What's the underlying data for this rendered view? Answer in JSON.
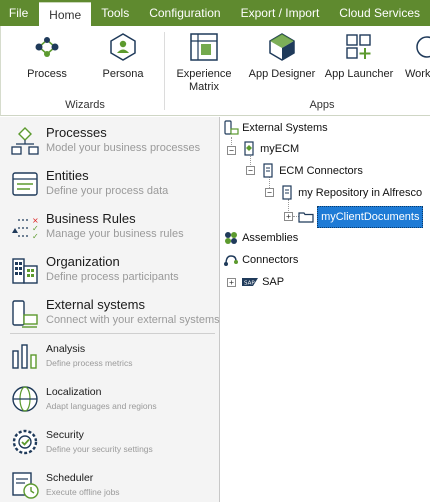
{
  "menubar": {
    "tabs": [
      {
        "label": "File"
      },
      {
        "label": "Home"
      },
      {
        "label": "Tools"
      },
      {
        "label": "Configuration"
      },
      {
        "label": "Export / Import"
      },
      {
        "label": "Cloud Services"
      }
    ],
    "active": "Home"
  },
  "ribbon": {
    "wizards": {
      "label": "Wizards",
      "buttons": [
        {
          "label": "Process",
          "icon": "process-icon"
        },
        {
          "label": "Persona",
          "icon": "persona-icon"
        }
      ]
    },
    "apps": {
      "label": "Apps",
      "buttons": [
        {
          "label": "Experience Matrix",
          "line1": "Experience",
          "line2": "Matrix",
          "icon": "experience-matrix-icon"
        },
        {
          "label": "App Designer",
          "icon": "app-designer-icon"
        },
        {
          "label": "App Launcher",
          "icon": "app-launcher-icon"
        },
        {
          "label": "Work",
          "icon": "work-icon"
        }
      ]
    },
    "colors": {
      "menubar": "#5f8a2f",
      "accent_green": "#5c9a2e",
      "icon_navy": "#1f3a5a"
    }
  },
  "leftnav": {
    "items": [
      {
        "title": "Processes",
        "subtitle": "Model your business processes",
        "icon": "processes-icon"
      },
      {
        "title": "Entities",
        "subtitle": "Define your process data",
        "icon": "entities-icon"
      },
      {
        "title": "Business Rules",
        "subtitle": "Manage your business rules",
        "icon": "business-rules-icon"
      },
      {
        "title": "Organization",
        "subtitle": "Define process participants",
        "icon": "organization-icon"
      },
      {
        "title": "External systems",
        "subtitle": "Connect with your external systems",
        "icon": "external-systems-icon"
      },
      {
        "title": "Analysis",
        "subtitle": "Define process metrics",
        "icon": "analysis-icon"
      },
      {
        "title": "Localization",
        "subtitle": "Adapt languages and regions",
        "icon": "localization-icon"
      },
      {
        "title": "Security",
        "subtitle": "Define your security settings",
        "icon": "security-icon"
      },
      {
        "title": "Scheduler",
        "subtitle": "Execute offline jobs",
        "icon": "scheduler-icon"
      }
    ]
  },
  "tree": {
    "nodes": [
      {
        "label": "External Systems",
        "icon": "external-systems-icon"
      },
      {
        "label": "myECM",
        "icon": "ecm-icon",
        "expander": "−"
      },
      {
        "label": "ECM Connectors",
        "icon": "connector-icon",
        "expander": "−"
      },
      {
        "label": "my Repository in Alfresco",
        "icon": "repository-icon",
        "expander": "−"
      },
      {
        "label": "myClientDocuments",
        "icon": "folder-icon",
        "expander": "+",
        "selected": true
      },
      {
        "label": "Assemblies",
        "icon": "assemblies-icon"
      },
      {
        "label": "Connectors",
        "icon": "connectors-icon"
      },
      {
        "label": "SAP",
        "icon": "sap-icon",
        "expander": "+"
      }
    ]
  }
}
